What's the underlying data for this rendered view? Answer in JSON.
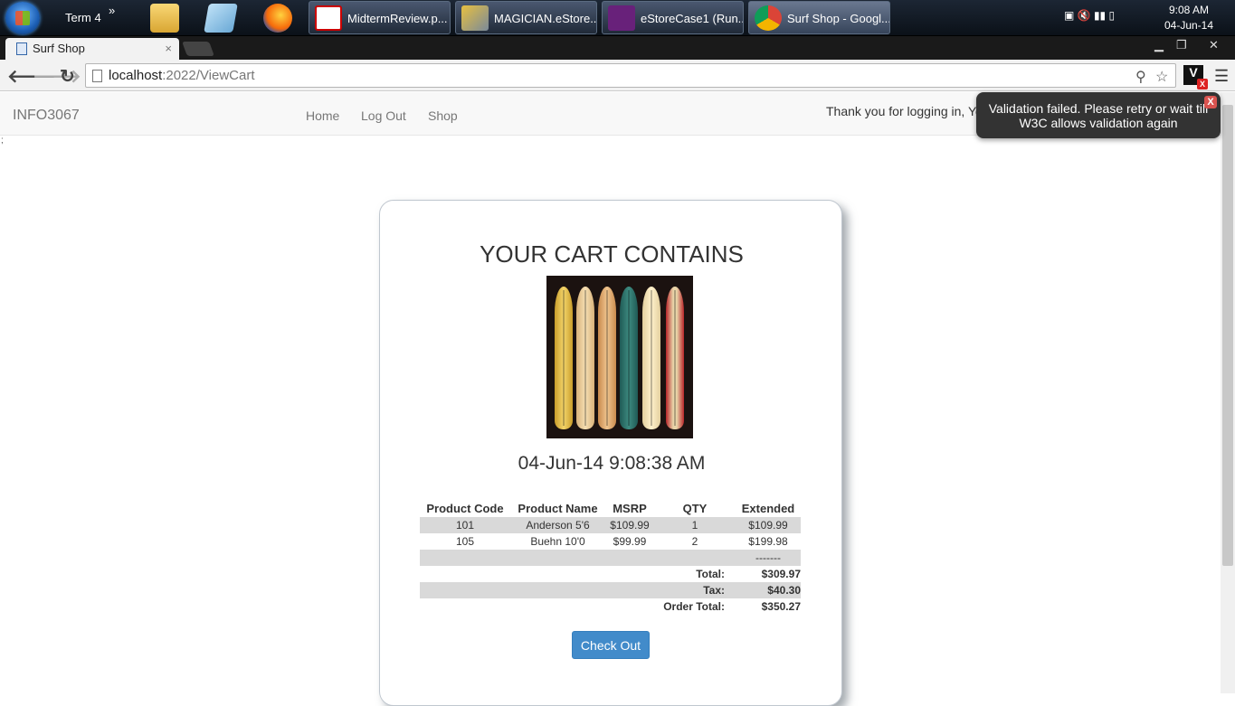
{
  "taskbar": {
    "term_label": "Term 4",
    "more": "»",
    "tasks": [
      {
        "label": "MidtermReview.p...",
        "icon": "pdf-icon"
      },
      {
        "label": "MAGICIAN.eStore...",
        "icon": "tools-icon"
      },
      {
        "label": "eStoreCase1 (Run...",
        "icon": "visual-studio-icon"
      },
      {
        "label": "Surf Shop - Googl...",
        "icon": "chrome-icon"
      }
    ],
    "clock_time": "9:08 AM",
    "clock_date": "04-Jun-14"
  },
  "browser": {
    "tab_title": "Surf Shop",
    "tab_close": "×",
    "url_host": "localhost",
    "url_path": ":2022/ViewCart"
  },
  "nav": {
    "brand": "INFO3067",
    "links": [
      "Home",
      "Log Out",
      "Shop"
    ],
    "thanks": "Thank you for logging in, You"
  },
  "stray_text": ";",
  "toast": {
    "message": "Validation failed. Please retry or wait till W3C allows validation again",
    "close": "X"
  },
  "cart": {
    "heading": "YOUR CART CONTAINS",
    "timestamp": "04-Jun-14 9:08:38 AM",
    "columns": [
      "Product Code",
      "Product Name",
      "MSRP",
      "QTY",
      "Extended"
    ],
    "rows": [
      {
        "code": "101",
        "name": "Anderson 5'6",
        "msrp": "$109.99",
        "qty": "1",
        "extended": "$109.99"
      },
      {
        "code": "105",
        "name": "Buehn 10'0",
        "msrp": "$99.99",
        "qty": "2",
        "extended": "$199.98"
      }
    ],
    "separator": "-------",
    "total_label": "Total:",
    "total": "$309.97",
    "tax_label": "Tax:",
    "tax": "$40.30",
    "order_total_label": "Order Total:",
    "order_total": "$350.27",
    "checkout_label": "Check Out"
  },
  "colors": {
    "accent": "#428bca",
    "navbar": "#f8f8f8",
    "shaded_row": "#d9d9d9"
  }
}
